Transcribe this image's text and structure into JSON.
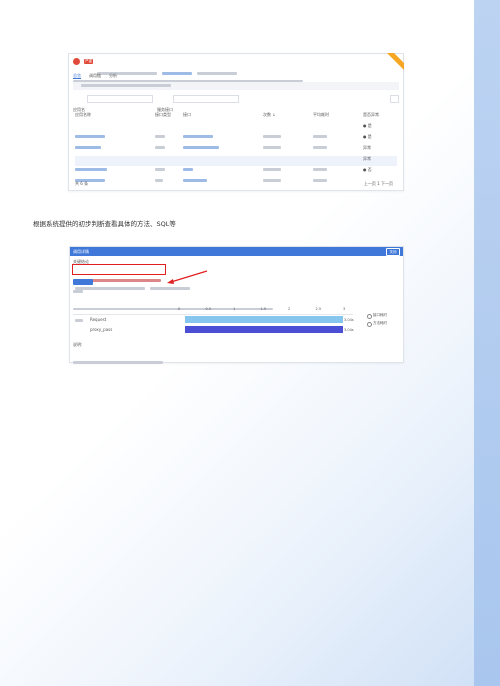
{
  "caption": "根据系统提供的初步判断查看具体的方法、SQL等",
  "top_screenshot": {
    "tag": "严重",
    "tabs": [
      "总览",
      "调用链",
      "分析"
    ],
    "filter_label_1": "应用名",
    "filter_label_2": "服务接口",
    "columns": [
      "应用名称",
      "接口类型",
      "接口",
      "次数 ↓",
      "平均耗时",
      "是否异常"
    ],
    "status_values": [
      "● 是",
      "● 是",
      "异常",
      "异常",
      "● 否",
      "● 否"
    ],
    "footer_left": "共 6 条",
    "footer_right": "上一页 1 下一页"
  },
  "bottom_screenshot": {
    "title": "调用详情",
    "close_label": "关闭",
    "section_label": "关键结论",
    "axis_ticks": [
      "0",
      "0.5",
      "1",
      "1.5",
      "2",
      "2.5",
      "3"
    ],
    "rows": [
      {
        "name": "Request",
        "value": "3.04s"
      },
      {
        "name": "proxy_pass",
        "value": "3.04s"
      }
    ],
    "legend": [
      "接口耗时",
      "方法耗时"
    ],
    "note_label": "说明:"
  }
}
